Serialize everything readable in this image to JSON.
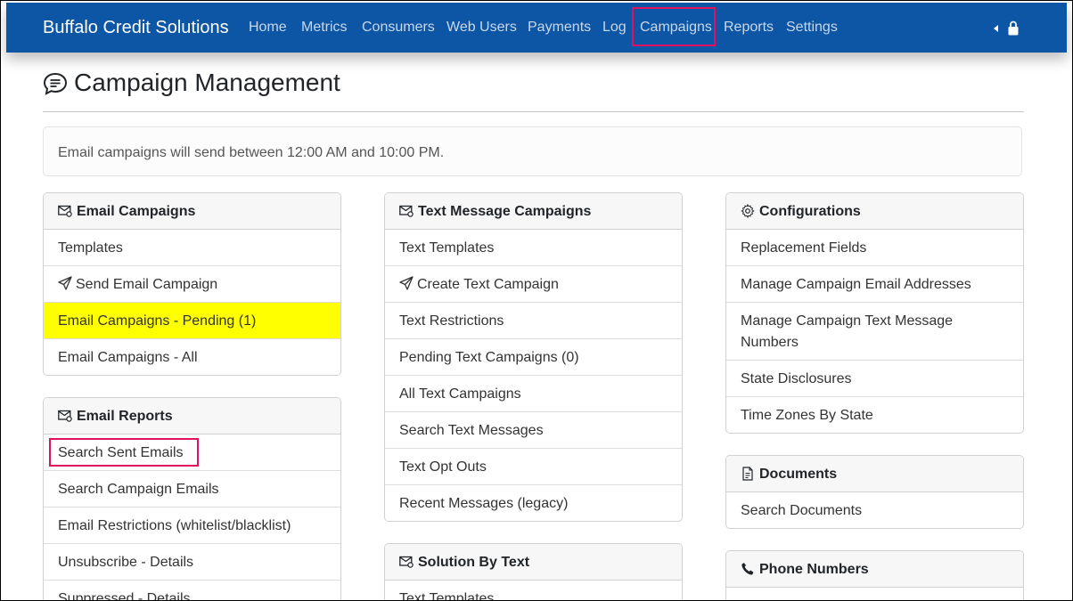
{
  "app": {
    "brand": "Buffalo Credit Solutions"
  },
  "nav": {
    "items": [
      "Home",
      "Metrics",
      "Consumers",
      "Web Users",
      "Payments",
      "Log",
      "Campaigns",
      "Reports",
      "Settings"
    ],
    "active": "Campaigns"
  },
  "page": {
    "title": "Campaign Management",
    "notice": "Email campaigns will send between 12:00 AM and 10:00 PM."
  },
  "email_campaigns": {
    "title": "Email Campaigns",
    "items": [
      "Templates",
      "Send Email Campaign",
      "Email Campaigns - Pending (1)",
      "Email Campaigns - All"
    ]
  },
  "email_reports": {
    "title": "Email Reports",
    "items": [
      "Search Sent Emails",
      "Search Campaign Emails",
      "Email Restrictions (whitelist/blacklist)",
      "Unsubscribe - Details",
      "Suppressed - Details"
    ]
  },
  "text_campaigns": {
    "title": "Text Message Campaigns",
    "items": [
      "Text Templates",
      "Create Text Campaign",
      "Text Restrictions",
      "Pending Text Campaigns (0)",
      "All Text Campaigns",
      "Search Text Messages",
      "Text Opt Outs",
      "Recent Messages (legacy)"
    ]
  },
  "solution_by_text": {
    "title": "Solution By Text",
    "items": [
      "Text Templates"
    ]
  },
  "configurations": {
    "title": "Configurations",
    "items": [
      "Replacement Fields",
      "Manage Campaign Email Addresses",
      "Manage Campaign Text Message Numbers",
      "State Disclosures",
      "Time Zones By State"
    ]
  },
  "documents": {
    "title": "Documents",
    "items": [
      "Search Documents"
    ]
  },
  "phone_numbers": {
    "title": "Phone Numbers"
  },
  "colors": {
    "navbar": "#0d56a6",
    "highlight": "#ffff00",
    "annotation": "#e0115f"
  }
}
